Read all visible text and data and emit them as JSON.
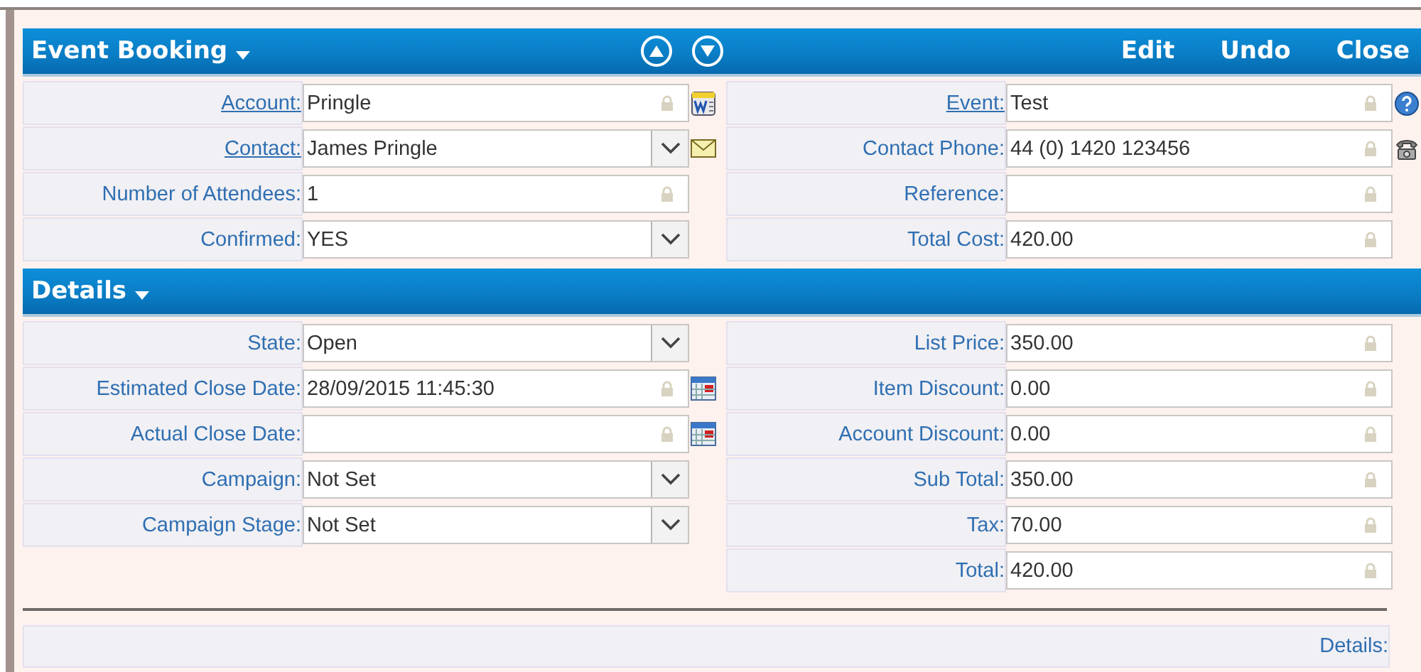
{
  "header": {
    "title": "Event Booking",
    "actions": [
      "Edit",
      "Undo",
      "Close"
    ]
  },
  "sections": [
    {
      "left": [
        {
          "label": "Account:",
          "link": true,
          "value": "Pringle",
          "kind": "locked",
          "button": {
            "kind": "document"
          }
        },
        {
          "label": "Contact:",
          "link": true,
          "value": "James Pringle",
          "kind": "dropdown",
          "button": {
            "kind": "mail"
          }
        },
        {
          "label": "Number of Attendees:",
          "link": false,
          "value": "1",
          "kind": "locked"
        },
        {
          "label": "Confirmed:",
          "link": false,
          "value": "YES",
          "kind": "dropdown"
        }
      ],
      "right": [
        {
          "label": "Event:",
          "link": true,
          "value": "Test",
          "kind": "locked",
          "button": {
            "kind": "help"
          }
        },
        {
          "label": "Contact Phone:",
          "link": false,
          "value": "44 (0) 1420 123456",
          "kind": "locked",
          "button": {
            "kind": "phone"
          }
        },
        {
          "label": "Reference:",
          "link": false,
          "kind": "locked"
        },
        {
          "label": "Total Cost:",
          "link": false,
          "value": "420.00",
          "kind": "locked"
        }
      ]
    },
    {
      "title": "Details",
      "left": [
        {
          "label": "State:",
          "link": false,
          "value": "Open",
          "kind": "dropdown"
        },
        {
          "label": "Estimated Close Date:",
          "link": false,
          "value": "28/09/2015 11:45:30",
          "kind": "locked",
          "button": {
            "kind": "calendar"
          }
        },
        {
          "label": "Actual Close Date:",
          "link": false,
          "kind": "locked",
          "button": {
            "kind": "calendar"
          }
        },
        {
          "label": "Campaign:",
          "link": false,
          "value": "Not Set",
          "kind": "dropdown"
        },
        {
          "label": "Campaign Stage:",
          "link": false,
          "value": "Not Set",
          "kind": "dropdown"
        }
      ],
      "right": [
        {
          "label": "List Price:",
          "link": false,
          "value": "350.00",
          "kind": "locked"
        },
        {
          "label": "Item Discount:",
          "link": false,
          "value": "0.00",
          "kind": "locked"
        },
        {
          "label": "Account Discount:",
          "link": false,
          "value": "0.00",
          "kind": "locked"
        },
        {
          "label": "Sub Total:",
          "link": false,
          "value": "350.00",
          "kind": "locked"
        },
        {
          "label": "Tax:",
          "link": false,
          "value": "70.00",
          "kind": "locked"
        },
        {
          "label": "Total:",
          "link": false,
          "value": "420.00",
          "kind": "locked"
        }
      ]
    }
  ],
  "footer": {
    "label": "Details:"
  }
}
